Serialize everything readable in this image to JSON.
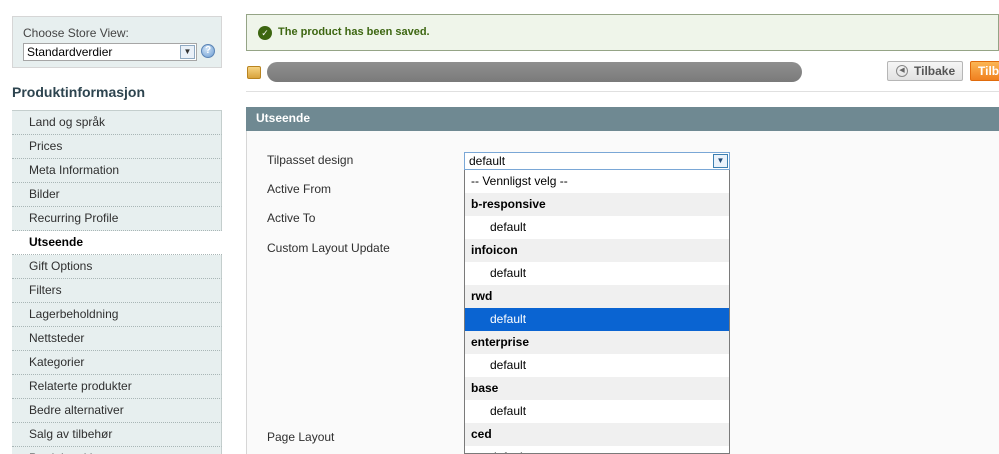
{
  "store": {
    "label": "Choose Store View:",
    "selected": "Standardverdier"
  },
  "tabs": {
    "title": "Produktinformasjon",
    "items": [
      {
        "label": "Land og språk"
      },
      {
        "label": "Prices"
      },
      {
        "label": "Meta Information"
      },
      {
        "label": "Bilder"
      },
      {
        "label": "Recurring Profile"
      },
      {
        "label": "Utseende",
        "active": true
      },
      {
        "label": "Gift Options"
      },
      {
        "label": "Filters"
      },
      {
        "label": "Lagerbeholdning"
      },
      {
        "label": "Nettsteder"
      },
      {
        "label": "Kategorier"
      },
      {
        "label": "Relaterte produkter"
      },
      {
        "label": "Bedre alternativer"
      },
      {
        "label": "Salg av tilbehør"
      },
      {
        "label": "Produktpakker"
      }
    ]
  },
  "message": {
    "text": "The product has been saved."
  },
  "header": {
    "back_label": "Tilbake",
    "orange_label": "Tilbake"
  },
  "section": {
    "title": "Utseende",
    "fields": {
      "design": "Tilpasset design",
      "active_from": "Active From",
      "active_to": "Active To",
      "custom_layout": "Custom Layout Update",
      "page_layout": "Page Layout"
    },
    "design_value": "default"
  },
  "dropdown": {
    "placeholder": "-- Vennligst velg --",
    "groups": [
      {
        "name": "b-responsive",
        "options": [
          "default"
        ]
      },
      {
        "name": "infoicon",
        "options": [
          "default"
        ]
      },
      {
        "name": "rwd",
        "options": [
          "default"
        ],
        "selected": 0
      },
      {
        "name": "enterprise",
        "options": [
          "default"
        ]
      },
      {
        "name": "base",
        "options": [
          "default"
        ]
      },
      {
        "name": "ced",
        "options": [
          "default"
        ]
      }
    ]
  },
  "icons": {
    "help": "help-icon",
    "success": "check-circle-icon",
    "product": "package-icon",
    "back": "back-arrow-icon"
  },
  "colors": {
    "section_header": "#6f8992",
    "selected_option": "#0a64d2",
    "success_text": "#3d6611",
    "orange_button": "#f08020"
  }
}
